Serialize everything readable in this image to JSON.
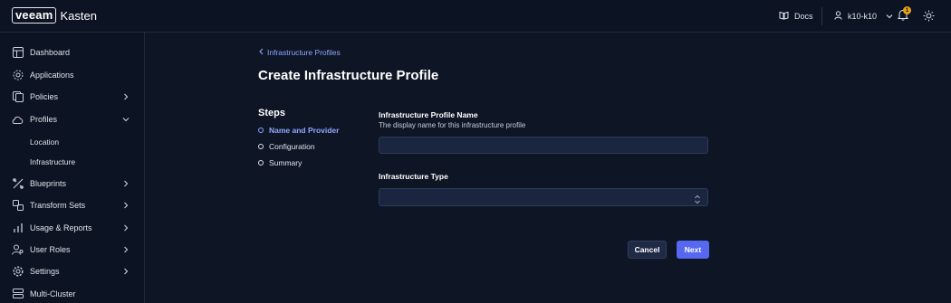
{
  "brand": {
    "logo_box": "veeam",
    "logo_text": "Kasten"
  },
  "topbar": {
    "docs_label": "Docs",
    "user_label": "k10-k10",
    "notification_count": "1",
    "icons": [
      "book-icon",
      "user-icon",
      "chevron-down-icon",
      "bell-icon",
      "sun-icon"
    ]
  },
  "sidebar": {
    "items": [
      {
        "label": "Dashboard",
        "icon": "dashboard-icon"
      },
      {
        "label": "Applications",
        "icon": "applications-icon"
      },
      {
        "label": "Policies",
        "icon": "policies-icon",
        "chevron": "right"
      },
      {
        "label": "Profiles",
        "icon": "profiles-icon",
        "chevron": "down"
      },
      {
        "label": "Blueprints",
        "icon": "blueprints-icon",
        "chevron": "right"
      },
      {
        "label": "Transform Sets",
        "icon": "transform-icon",
        "chevron": "right"
      },
      {
        "label": "Usage & Reports",
        "icon": "chart-icon",
        "chevron": "right"
      },
      {
        "label": "User Roles",
        "icon": "user-roles-icon",
        "chevron": "right"
      },
      {
        "label": "Settings",
        "icon": "settings-icon",
        "chevron": "right"
      },
      {
        "label": "Multi-Cluster",
        "icon": "multi-cluster-icon"
      }
    ],
    "profiles_sub": [
      {
        "label": "Location"
      },
      {
        "label": "Infrastructure"
      }
    ]
  },
  "main": {
    "back_link": "Infrastructure Profiles",
    "title": "Create Infrastructure Profile",
    "steps_title": "Steps",
    "steps": [
      {
        "label": "Name and Provider",
        "active": true
      },
      {
        "label": "Configuration",
        "active": false
      },
      {
        "label": "Summary",
        "active": false
      }
    ],
    "name_field": {
      "label": "Infrastructure Profile Name",
      "help": "The display name for this infrastructure profile",
      "value": "",
      "placeholder": ""
    },
    "type_field": {
      "label": "Infrastructure Type",
      "selected": ""
    },
    "buttons": {
      "cancel": "Cancel",
      "next": "Next"
    }
  },
  "colors": {
    "background": "#0e1525",
    "sidebar": "#0c1322",
    "accent": "#5667f0",
    "link": "#8fa8ff",
    "input_bg": "#1a2540",
    "badge": "#e8a217"
  }
}
